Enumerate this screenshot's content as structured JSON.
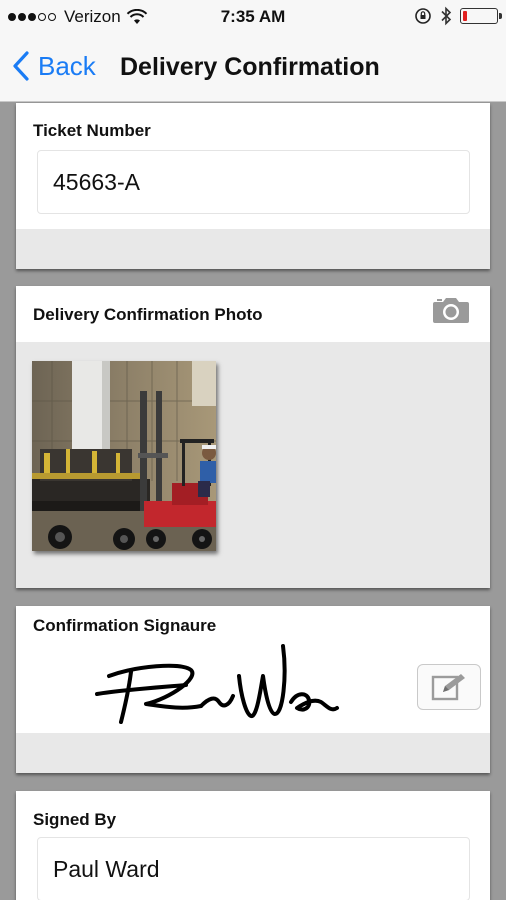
{
  "status_bar": {
    "signal_dots_filled": 3,
    "signal_dots_total": 5,
    "carrier": "Verizon",
    "time": "7:35 AM",
    "battery_level": 0.12,
    "battery_color": "#e02020"
  },
  "nav": {
    "back_label": "Back",
    "title": "Delivery Confirmation",
    "accent_color": "#1a7cf5"
  },
  "ticket": {
    "label": "Ticket Number",
    "value": "45663-A"
  },
  "photo_section": {
    "label": "Delivery Confirmation Photo",
    "icon": "camera-icon"
  },
  "signature_section": {
    "label": "Confirmation Signaure",
    "edit_icon": "edit-signature-icon"
  },
  "signed_by": {
    "label": "Signed By",
    "value": "Paul Ward"
  }
}
